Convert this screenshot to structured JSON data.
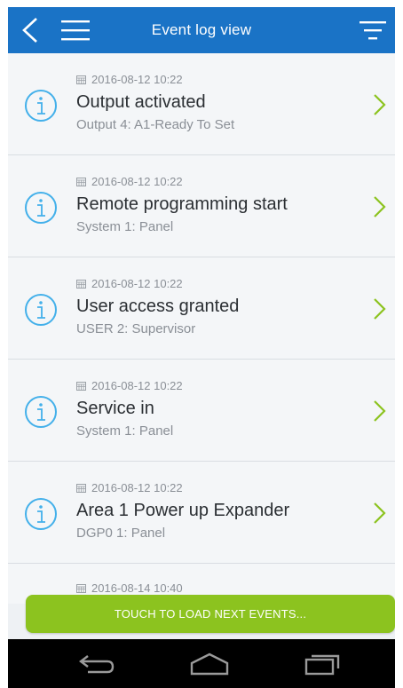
{
  "header": {
    "title": "Event log view",
    "back_icon": "chevron-left-icon",
    "menu_icon": "hamburger-menu-icon",
    "filter_icon": "filter-icon",
    "bar_color": "#1a73c6"
  },
  "events": [
    {
      "timestamp": "2016-08-12 10:22",
      "title": "Output activated",
      "subtitle": "Output 4: A1-Ready To Set"
    },
    {
      "timestamp": "2016-08-12 10:22",
      "title": "Remote programming start",
      "subtitle": "System 1: Panel"
    },
    {
      "timestamp": "2016-08-12 10:22",
      "title": "User access granted",
      "subtitle": "USER 2: Supervisor"
    },
    {
      "timestamp": "2016-08-12 10:22",
      "title": "Service in",
      "subtitle": "System 1: Panel"
    },
    {
      "timestamp": "2016-08-12 10:22",
      "title": "Area 1 Power up Expander",
      "subtitle": "DGP0 1: Panel"
    },
    {
      "timestamp": "2016-08-14 10:40"
    }
  ],
  "load_more": {
    "label": "TOUCH TO LOAD NEXT EVENTS...",
    "color": "#8cc31f"
  },
  "nav": {
    "back_icon": "android-back-icon",
    "home_icon": "android-home-icon",
    "recents_icon": "android-recents-icon"
  }
}
